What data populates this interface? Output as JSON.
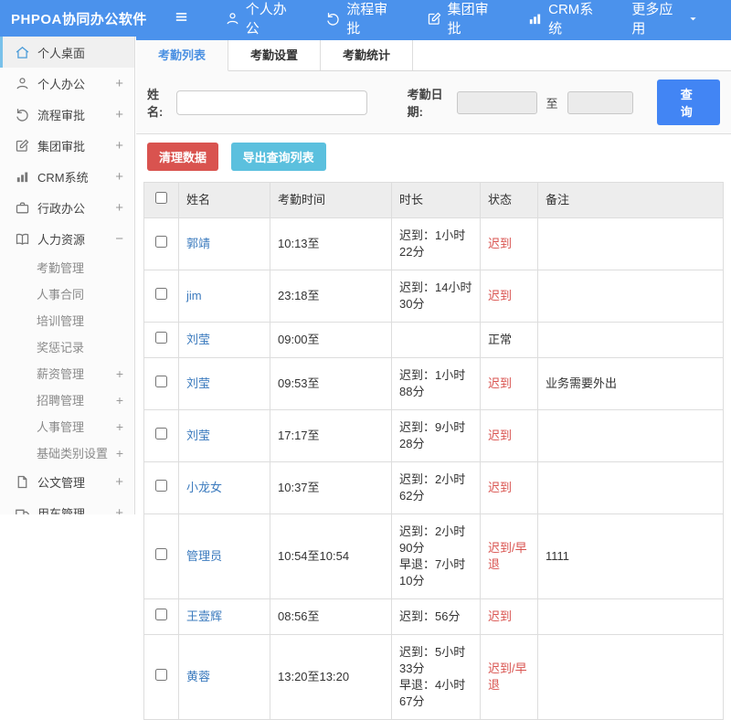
{
  "topbar": {
    "logo": "PHPOA协同办公软件",
    "nav": [
      {
        "icon": "user-icon",
        "label": "个人办公"
      },
      {
        "icon": "flow-icon",
        "label": "流程审批"
      },
      {
        "icon": "edit-icon",
        "label": "集团审批"
      },
      {
        "icon": "chart-icon",
        "label": "CRM系统"
      },
      {
        "icon": "caret-down-icon",
        "label": "更多应用",
        "caret": true
      }
    ]
  },
  "sidebar": {
    "items": [
      {
        "type": "main",
        "icon": "home-icon",
        "label": "个人桌面",
        "active": true
      },
      {
        "type": "main",
        "icon": "user-icon",
        "label": "个人办公",
        "expand": "+"
      },
      {
        "type": "main",
        "icon": "flow-icon",
        "label": "流程审批",
        "expand": "+"
      },
      {
        "type": "main",
        "icon": "edit-icon",
        "label": "集团审批",
        "expand": "+"
      },
      {
        "type": "main",
        "icon": "chart-icon",
        "label": "CRM系统",
        "expand": "+"
      },
      {
        "type": "main",
        "icon": "briefcase-icon",
        "label": "行政办公",
        "expand": "+"
      },
      {
        "type": "main",
        "icon": "book-icon",
        "label": "人力资源",
        "expand": "−"
      },
      {
        "type": "sub",
        "label": "考勤管理"
      },
      {
        "type": "sub",
        "label": "人事合同"
      },
      {
        "type": "sub",
        "label": "培训管理"
      },
      {
        "type": "sub",
        "label": "奖惩记录"
      },
      {
        "type": "sub",
        "label": "薪资管理",
        "expand": "+"
      },
      {
        "type": "sub",
        "label": "招聘管理",
        "expand": "+"
      },
      {
        "type": "sub",
        "label": "人事管理",
        "expand": "+"
      },
      {
        "type": "sub",
        "label": "基础类别设置",
        "expand": "+"
      },
      {
        "type": "main",
        "icon": "doc-icon",
        "label": "公文管理",
        "expand": "+"
      },
      {
        "type": "main",
        "icon": "car-icon",
        "label": "用车管理",
        "expand": "+"
      }
    ]
  },
  "tabs": [
    {
      "label": "考勤列表",
      "active": true
    },
    {
      "label": "考勤设置",
      "active": false
    },
    {
      "label": "考勤统计",
      "active": false
    }
  ],
  "filter": {
    "name_label": "姓名:",
    "date_label": "考勤日期:",
    "to_label": "至",
    "search_label": "查 询"
  },
  "actions": {
    "clean_label": "清理数据",
    "export_label": "导出查询列表"
  },
  "colors": {
    "topbar_blue": "#4b92ec",
    "search_blue": "#4285f4",
    "danger_red": "#d9534f",
    "info_teal": "#5bc0de",
    "link_blue": "#3c7bbe"
  },
  "table": {
    "headers": [
      "姓名",
      "考勤时间",
      "时长",
      "状态",
      "备注"
    ],
    "rows": [
      {
        "name": "郭靖",
        "time": "10:13至",
        "duration": [
          "迟到：1小时22分"
        ],
        "status": "迟到",
        "alert": true,
        "remark": ""
      },
      {
        "name": "jim",
        "time": "23:18至",
        "duration": [
          "迟到：14小时30分"
        ],
        "status": "迟到",
        "alert": true,
        "remark": ""
      },
      {
        "name": "刘莹",
        "time": "09:00至",
        "duration": [],
        "status": "正常",
        "alert": false,
        "remark": ""
      },
      {
        "name": "刘莹",
        "time": "09:53至",
        "duration": [
          "迟到：1小时88分"
        ],
        "status": "迟到",
        "alert": true,
        "remark": "业务需要外出"
      },
      {
        "name": "刘莹",
        "time": "17:17至",
        "duration": [
          "迟到：9小时28分"
        ],
        "status": "迟到",
        "alert": true,
        "remark": ""
      },
      {
        "name": "小龙女",
        "time": "10:37至",
        "duration": [
          "迟到：2小时62分"
        ],
        "status": "迟到",
        "alert": true,
        "remark": ""
      },
      {
        "name": "管理员",
        "time": "10:54至10:54",
        "duration": [
          "迟到：2小时90分",
          "早退：7小时10分"
        ],
        "status": "迟到/早退",
        "alert": true,
        "remark": "1111"
      },
      {
        "name": "王壹辉",
        "time": "08:56至",
        "duration": [
          "迟到：56分"
        ],
        "status": "迟到",
        "alert": true,
        "remark": ""
      },
      {
        "name": "黄蓉",
        "time": "13:20至13:20",
        "duration": [
          "迟到：5小时33分",
          "早退：4小时67分"
        ],
        "status": "迟到/早退",
        "alert": true,
        "remark": ""
      }
    ]
  }
}
